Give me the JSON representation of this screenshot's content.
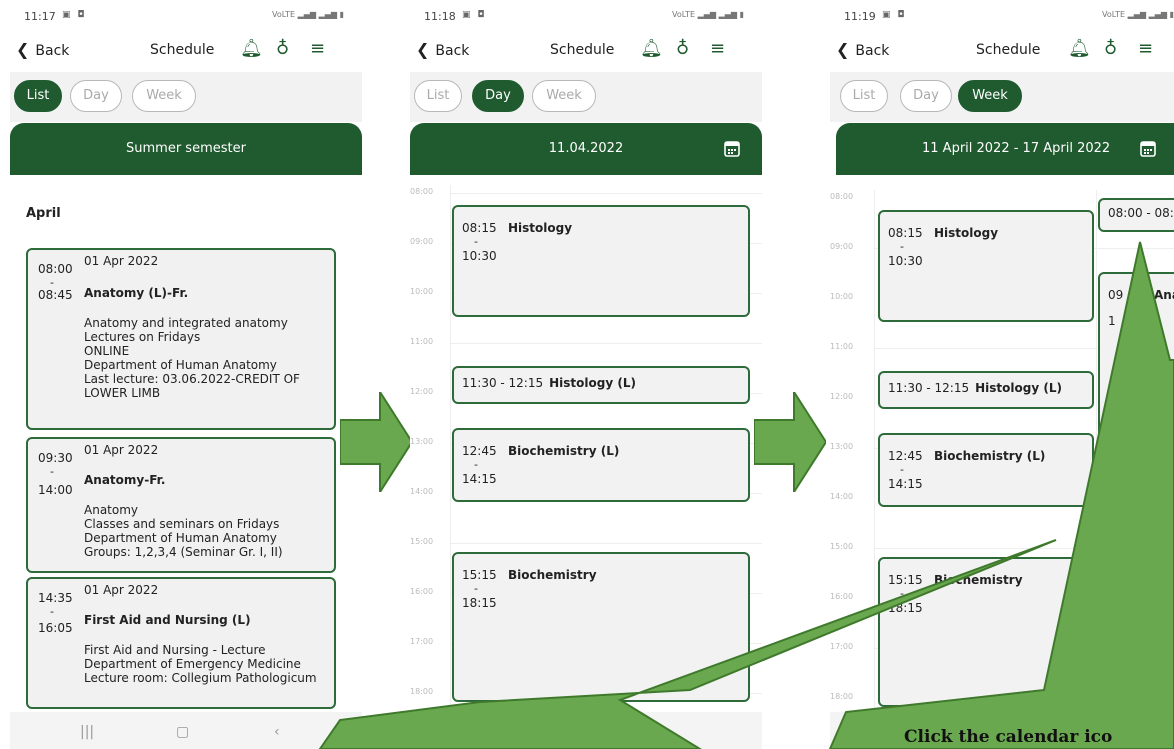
{
  "common": {
    "back_label": "Back",
    "screen_title": "Schedule",
    "tabs": [
      "List",
      "Day",
      "Week"
    ]
  },
  "screens": [
    {
      "time": "11:17",
      "active_tab": "List",
      "banner": "Summer semester",
      "month": "April",
      "entries": [
        {
          "date": "01 Apr 2022",
          "start": "08:00",
          "end": "08:45",
          "title": "Anatomy (L)-Fr.",
          "description": "Anatomy and integrated anatomy\nLectures on Fridays\nONLINE\nDepartment of Human Anatomy\nLast lecture: 03.06.2022-CREDIT OF LOWER LIMB"
        },
        {
          "date": "01 Apr 2022",
          "start": "09:30",
          "end": "14:00",
          "title": "Anatomy-Fr.",
          "description": "Anatomy\nClasses and seminars on Fridays\nDepartment of Human Anatomy\nGroups: 1,2,3,4 (Seminar Gr. I, II)"
        },
        {
          "date": "01 Apr 2022",
          "start": "14:35",
          "end": "16:05",
          "title": "First Aid and Nursing (L)",
          "description": "First Aid and Nursing - Lecture\nDepartment of Emergency Medicine\nLecture room: Collegium Pathologicum"
        }
      ]
    },
    {
      "time": "11:18",
      "active_tab": "Day",
      "banner": "11.04.2022",
      "hours": [
        "08:00",
        "09:00",
        "10:00",
        "11:00",
        "12:00",
        "13:00",
        "14:00",
        "15:00",
        "16:00",
        "17:00",
        "18:00"
      ],
      "events": [
        {
          "start": "08:15",
          "end": "10:30",
          "title": "Histology"
        },
        {
          "inline": "11:30 - 12:15",
          "title": "Histology (L)"
        },
        {
          "start": "12:45",
          "end": "14:15",
          "title": "Biochemistry (L)"
        },
        {
          "start": "15:15",
          "end": "18:15",
          "title": "Biochemistry"
        }
      ]
    },
    {
      "time": "11:19",
      "active_tab": "Week",
      "banner": "11 April 2022 - 17 April 2022",
      "hours": [
        "08:00",
        "09:00",
        "10:00",
        "11:00",
        "12:00",
        "13:00",
        "14:00",
        "15:00",
        "16:00",
        "17:00",
        "18:00"
      ],
      "events": [
        {
          "start": "08:15",
          "end": "10:30",
          "title": "Histology"
        },
        {
          "inline": "11:30 - 12:15",
          "title": "Histology (L)"
        },
        {
          "start": "12:45",
          "end": "14:15",
          "title": "Biochemistry (L)"
        },
        {
          "start": "15:15",
          "end": "18:15",
          "title": "Biochemistry"
        }
      ],
      "partial_event_1": "08:00 - 08:",
      "partial_event_2_time": "09",
      "partial_event_2_title": "Ana",
      "partial_event_2_line": "1"
    }
  ],
  "annotation": {
    "callout_text": "Click the calendar ico",
    "colors": {
      "brand_green": "#1f5b2f",
      "arrow_green": "#6aa84f",
      "callout_green": "#6aa84f"
    }
  }
}
